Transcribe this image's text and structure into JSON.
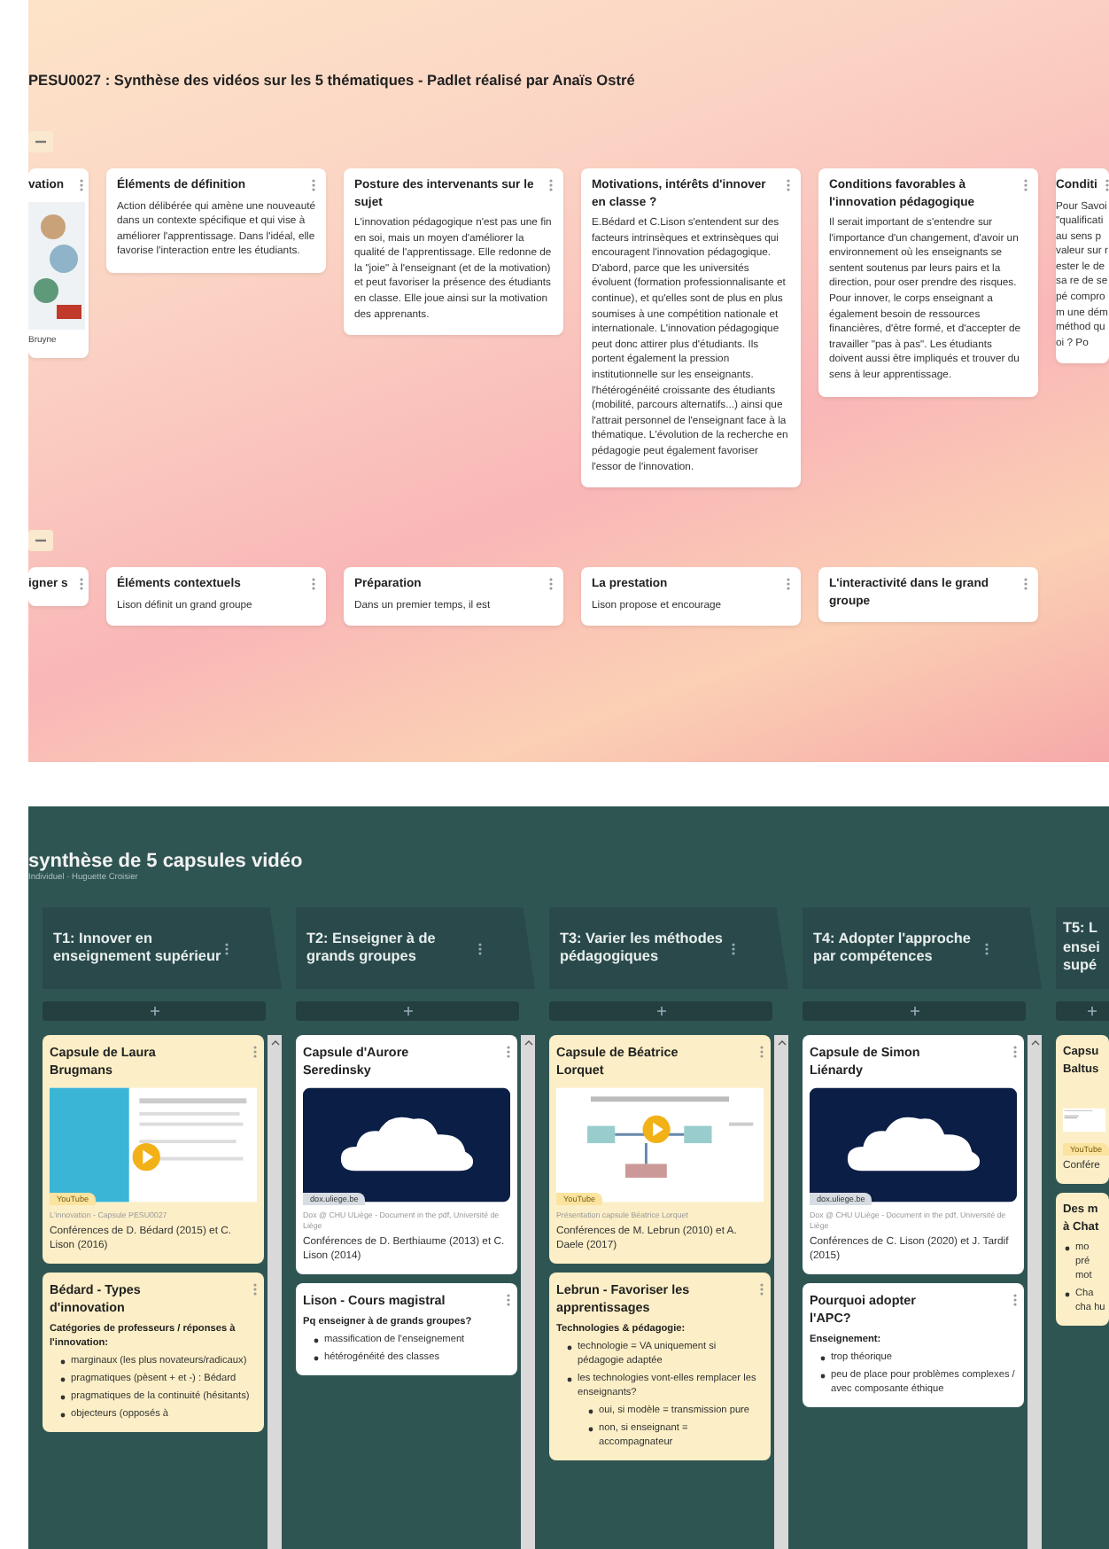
{
  "board_top": {
    "title": "PESU0027 : Synthèse des vidéos sur les 5 thématiques - Padlet réalisé par Anaïs Ostré",
    "sections": [
      {
        "cards": [
          {
            "title": "vation",
            "media": {
              "kind": "illustration"
            },
            "caption": "Bruyne",
            "cut": true
          },
          {
            "title": "Éléments de définition",
            "body": "Action délibérée qui amène une nouveauté dans un contexte spécifique et qui vise à améliorer l'apprentissage. Dans l'idéal, elle favorise l'interaction entre les étudiants."
          },
          {
            "title": "Posture des intervenants sur le sujet",
            "body": "L'innovation pédagogique n'est pas une fin en soi, mais un moyen d'améliorer la qualité de l'apprentissage. Elle redonne de la \"joie\" à l'enseignant (et de la motivation) et peut favoriser la présence des étudiants en classe. Elle joue ainsi sur la motivation des apprenants."
          },
          {
            "title": "Motivations, intérêts d'innover en classe ?",
            "body": "E.Bédard et C.Lison s'entendent sur des facteurs intrinsèques et extrinsèques qui encouragent l'innovation pédagogique. D'abord, parce que les universités évoluent (formation professionnalisante et continue), et qu'elles sont de plus en plus soumises à une compétition nationale et internationale. L'innovation pédagogique peut donc attirer plus d'étudiants. Ils portent également la pression institutionnelle sur les enseignants. l'hétérogénéité croissante des étudiants (mobilité, parcours alternatifs...) ainsi que l'attrait personnel de l'enseignant face à la thématique. L'évolution de la recherche en pédagogie peut également favoriser l'essor de l'innovation."
          },
          {
            "title": "Conditions favorables à l'innovation pédagogique",
            "body": "Il serait important de s'entendre sur l'importance d'un changement, d'avoir un environnement où les enseignants se sentent soutenus par leurs pairs et la direction, pour oser prendre des risques. Pour innover, le corps enseignant a également besoin de ressources financières, d'être formé, et d'accepter de travailler \"pas à pas\". Les étudiants doivent aussi être impliqués et trouver du sens à leur apprentissage."
          },
          {
            "title": "Conditi",
            "body": "Pour Savoi \"qualificati au sens p valeur sur rester le de sa re de se pé comprom une dém méthod quoi ? Po",
            "cut": true
          }
        ]
      },
      {
        "cards": [
          {
            "title": "igner s",
            "cut": true
          },
          {
            "title": "Éléments contextuels",
            "body": "Lison définit un grand groupe"
          },
          {
            "title": "Préparation",
            "body": "Dans un premier temps, il est"
          },
          {
            "title": "La prestation",
            "body": "Lison propose et encourage"
          },
          {
            "title": "L'interactivité dans le grand groupe"
          }
        ]
      }
    ]
  },
  "board_bottom": {
    "title": "synthèse de 5 capsules vidéo",
    "subtitle": "Individuel · Huguette Croisier",
    "columns": [
      {
        "title": "T1: Innover en enseignement supérieur",
        "cards": [
          {
            "color": "#fcefc7",
            "title": "Capsule de Laura Brugmans",
            "media": {
              "kind": "video"
            },
            "badge": "YouTube",
            "source": "L'innovation - Capsule PESU0027",
            "text": "Conférences de D. Bédard (2015) et C. Lison (2016)"
          },
          {
            "color": "#fcefc7",
            "title": "Bédard - Types d'innovation",
            "heading": "Catégories de professeurs / réponses à l'innovation:",
            "bullets": [
              {
                "text": "marginaux (les plus novateurs/radicaux)"
              },
              {
                "text": "pragmatiques (pèsent + et -) : Bédard"
              },
              {
                "text": "pragmatiques de la continuité (hésitants)"
              },
              {
                "text": "objecteurs (opposés à"
              }
            ]
          }
        ]
      },
      {
        "title": "T2: Enseigner à de grands groupes",
        "cards": [
          {
            "color": "#ffffff",
            "title": "Capsule d'Aurore Seredinsky",
            "media": {
              "kind": "cloud"
            },
            "badge": "dox.uliege.be",
            "source": "Dox @ CHU ULiège - Document in the pdf, Université de Liège",
            "text": "Conférences de D. Berthiaume (2013) et C. Lison (2014)"
          },
          {
            "color": "#ffffff",
            "title": "Lison - Cours magistral",
            "heading": "Pq enseigner à de grands groupes?",
            "bullets": [
              {
                "text": "massification de l'enseignement"
              },
              {
                "text": "hétérogénéité des classes"
              }
            ]
          }
        ]
      },
      {
        "title": "T3: Varier les méthodes pédagogiques",
        "cards": [
          {
            "color": "#fcefc7",
            "title": "Capsule de Béatrice Lorquet",
            "media": {
              "kind": "diagram"
            },
            "badge": "YouTube",
            "source": "Présentation capsule Béatrice Lorquet",
            "text": "Conférences de M. Lebrun (2010) et A. Daele (2017)"
          },
          {
            "color": "#fcefc7",
            "title": "Lebrun - Favoriser les apprentissages",
            "heading": "Technologies & pédagogie:",
            "bullets": [
              {
                "text": "technologie = VA uniquement si pédagogie adaptée"
              },
              {
                "text": "les technologies vont-elles remplacer les enseignants?",
                "children": [
                  {
                    "text": "oui, si modèle = transmission pure"
                  },
                  {
                    "text": "non, si enseignant = accompagnateur"
                  }
                ]
              }
            ]
          }
        ]
      },
      {
        "title": "T4: Adopter l'approche par compétences",
        "cards": [
          {
            "color": "#ffffff",
            "title": "Capsule de Simon Liénardy",
            "media": {
              "kind": "cloud"
            },
            "badge": "dox.uliege.be",
            "source": "Dox @ CHU ULiège - Document in the pdf, Université de Liège",
            "text": "Conférences de C. Lison (2020) et J. Tardif (2015)"
          },
          {
            "color": "#ffffff",
            "title": "Pourquoi adopter l'APC?",
            "heading": "Enseignement:",
            "bullets": [
              {
                "text": "trop théorique"
              },
              {
                "text": "peu de place pour problèmes complexes / avec composante éthique"
              }
            ]
          }
        ]
      },
      {
        "title": "T5: L ensei supé",
        "cut": true,
        "cards": [
          {
            "color": "#fcefc7",
            "title": "Capsu Baltus",
            "media": {
              "kind": "document"
            },
            "badge": "YouTube",
            "text": "Confére"
          },
          {
            "color": "#fcefc7",
            "title": "Des m à Chat",
            "bullets": [
              {
                "text": "mo pré mot"
              },
              {
                "text": "Cha cha hu"
              }
            ]
          }
        ]
      }
    ]
  }
}
